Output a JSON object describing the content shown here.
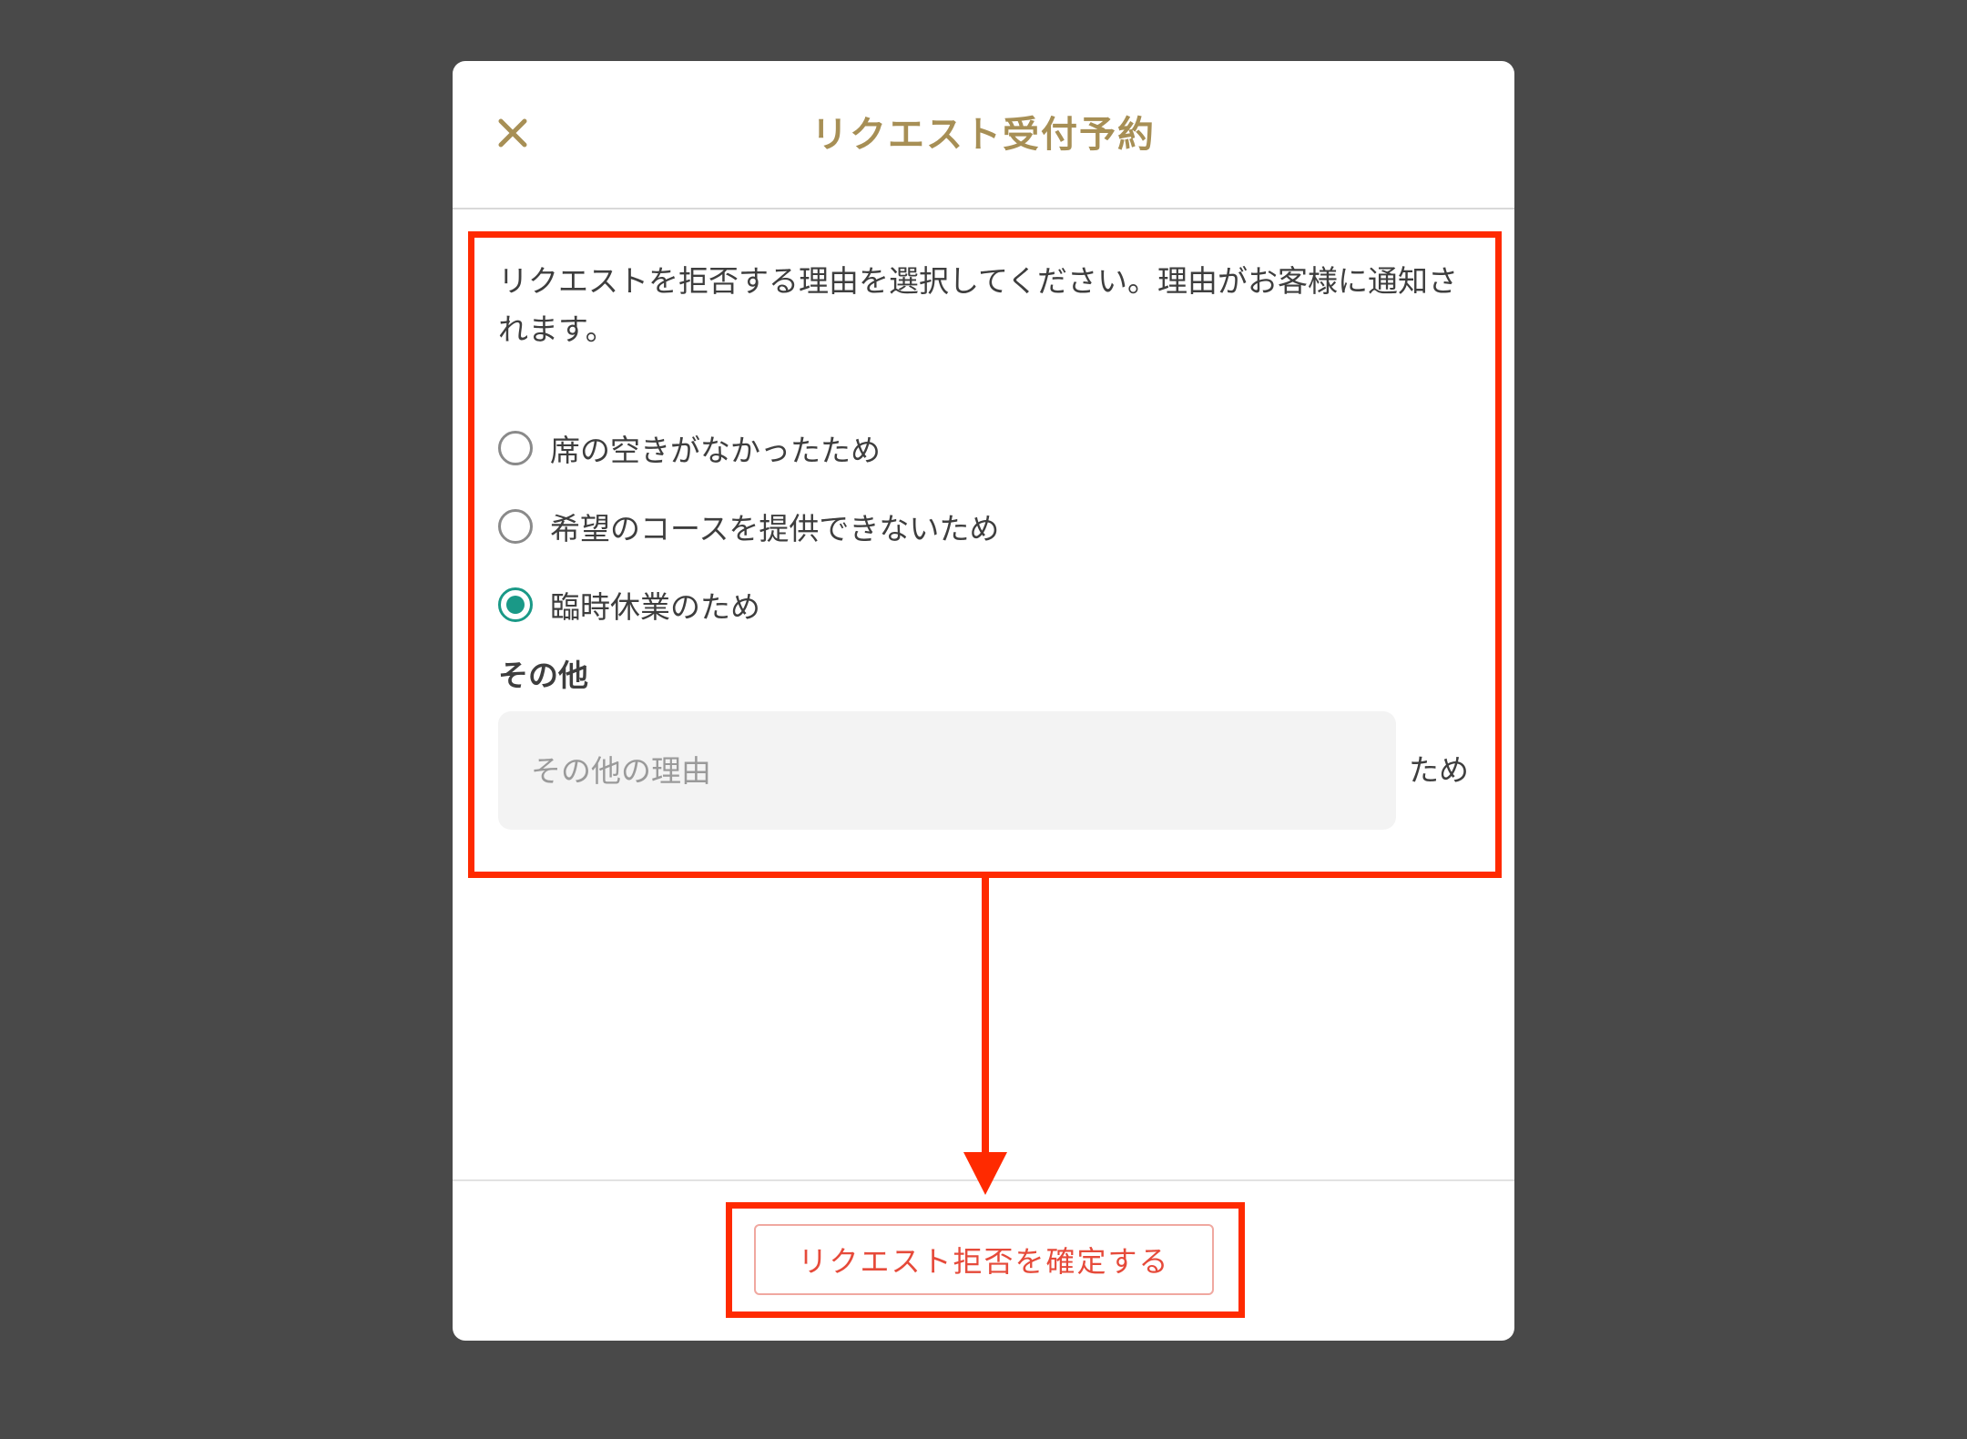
{
  "modal": {
    "title": "リクエスト受付予約",
    "close_icon": "close-icon",
    "instruction": "リクエストを拒否する理由を選択してください。理由がお客様に通知されます。",
    "reasons": [
      {
        "label": "席の空きがなかったため",
        "checked": false
      },
      {
        "label": "希望のコースを提供できないため",
        "checked": false
      },
      {
        "label": "臨時休業のため",
        "checked": true
      }
    ],
    "other": {
      "heading": "その他",
      "placeholder": "その他の理由",
      "value": "",
      "suffix": "ため"
    },
    "confirm_label": "リクエスト拒否を確定する"
  },
  "colors": {
    "backdrop": "#494949",
    "title_accent": "#a78f55",
    "radio_checked": "#1a9987",
    "confirm_text": "#e64a3a",
    "annotation": "#ff2a00"
  }
}
